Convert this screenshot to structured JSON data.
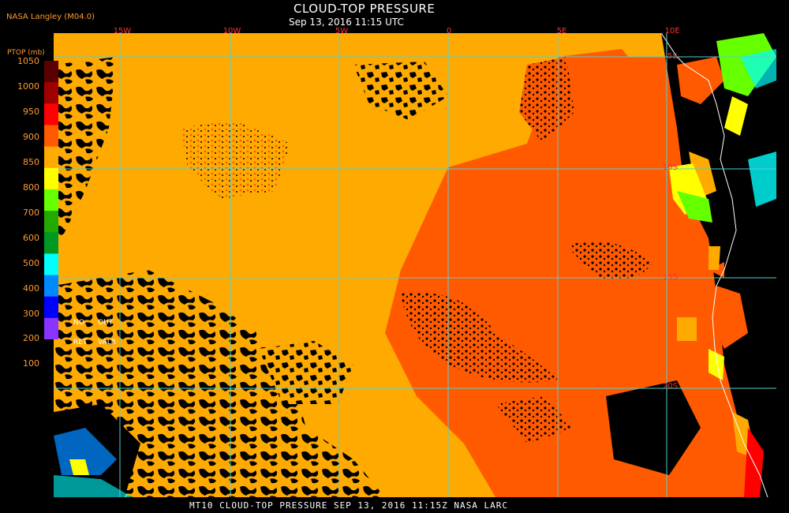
{
  "header": {
    "credit": "NASA Langley (M04.0)",
    "title": "CLOUD-TOP PRESSURE",
    "subtitle": "Sep 13, 2016 11:15 UTC"
  },
  "footer": {
    "text": "MT10  CLOUD-TOP PRESSURE  SEP 13, 2016 11:15Z  NASA LARC"
  },
  "colorbar": {
    "label": "PTOP (mb)",
    "ticks": [
      "1050",
      "1000",
      "950",
      "900",
      "850",
      "800",
      "700",
      "600",
      "500",
      "400",
      "300",
      "200",
      "100"
    ],
    "colors": [
      "#5a0000",
      "#a00000",
      "#ff0000",
      "#ff5a00",
      "#ffaa00",
      "#ffff00",
      "#66ff00",
      "#22aa00",
      "#009922",
      "#00ffff",
      "#0088ff",
      "#0000ff",
      "#8833ff"
    ],
    "notes": {
      "no": "NO",
      "out": "OUT",
      "ret": "RET",
      "valr": "VALR"
    }
  },
  "map_labels": {
    "longitudes": [
      "15W",
      "10W",
      "5W",
      "0",
      "5E",
      "10E"
    ],
    "latitudes": [
      "5S",
      "10S",
      "15S",
      "20S"
    ]
  },
  "colors": {
    "grid": "#55d0d0",
    "label": "#ff3030",
    "cloud_low": "#ffaa00",
    "cloud_mid": "#ff5a00",
    "clear": "#000000"
  }
}
